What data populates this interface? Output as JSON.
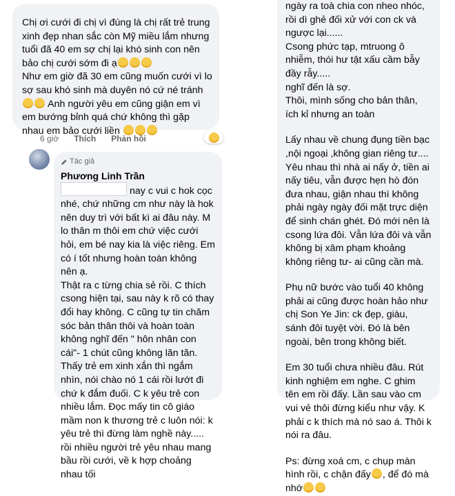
{
  "comment1": {
    "text": "Chị ơi cưới đi chị vì đúng là chị rất trẻ trung xinh đẹp nhan sắc còn Mỹ miều lắm nhưng tuổi đã 40 em sợ chị lại khó sinh con nên bảo chị cưới sớm đi ạ",
    "text2": "Như em giờ đã 30 em cũng muốn cưới vì lo sợ sau khó sinh mà duyên nó cứ né tránh",
    "text3": "Anh người yêu em cũng giận em vì em bướng bỉnh quá chứ không thì gặp nhau em bảo cưới liền",
    "time": "6 giờ",
    "like": "Thích",
    "reply": "Phản hồi"
  },
  "comment2": {
    "badge": "Tác giả",
    "author": "Phương Linh Trần",
    "p1": "nay c vui c hok cọc nhé, chứ những cm như này là hok nên duy trì với bất kì ai đâu này. M lo thân m thôi em chứ việc cưới hỏi, em bé nay kia là việc riêng. Em có í tốt nhưng hoàn toàn không nên ạ.",
    "p2": "Thật ra c từng chia sẻ rồi. C thích csong hiện tại, sau này k rõ có thay đổi hay không. C cũng tự tin chăm sóc bản thân thôi và hoàn toàn không nghĩ đến \" hôn nhân con cái\"- 1 chút cũng không lăn tăn. Thấy trẻ em xinh xắn thì ngắm nhìn, nói chào nó 1 cái rồi lướt đi chứ k đắm đuối. C k yêu trẻ con nhiều lắm. Đọc mấy tin cô giáo mầm non k thương trẻ c luôn nói: k yêu trẻ thì đừng làm nghề này..... rồi nhiều người trẻ yêu nhau mang bầu rồi cưới, về k hợp choảng nhau tối"
  },
  "comment3": {
    "p1": "ngày ra toà chia con nheo nhóc, rồi dì ghẻ đối xử với con ck và ngược lại......\nCsong phức tạp, mtruong ô nhiễm, thói hư tật xấu cầm bẫy đầy rẫy.....\nnghĩ đến là sợ.\nThôi, mình sống cho bản thân, ích kỉ nhưng an toàn",
    "p2": "Lấy nhau về chung đụng tiền bạc ,nội ngoại ,không gian riêng tư....\nYêu nhau thì nhà ai nấy ở, tiền ai nấy tiêu, vẫn được hẹn hò đón đưa nhau, giận nhau thì không phải ngày ngày đối mặt trực diện để sinh chán ghét. Đó mới nên là csong lứa đôi. Vẫn lứa đôi và vẫn không bị xâm phạm khoảng không riêng tư- ai cũng cần mà.",
    "p3": "Phụ nữ bước vào tuổi 40 không phải ai cũng được hoàn hảo như chị Son Ye Jin: ck đẹp, giàu, sánh đôi tuyệt vời. Đó là bên ngoài, bên trong không biết.",
    "p4": "Em 30 tuổi chưa nhiều đâu. Rút kinh nghiệm em nghe. C ghim tên em rồi đấy. Lần sau vào cm vui vẻ thôi đừng kiểu như vậy. K phải c k thích mà nó sao á. Thôi k nói ra đâu.",
    "p5": "Ps: đừng xoá cm, c chụp màn hình rồi, c chặn đấy",
    "p5_end": ", để đó mà nhớ"
  }
}
